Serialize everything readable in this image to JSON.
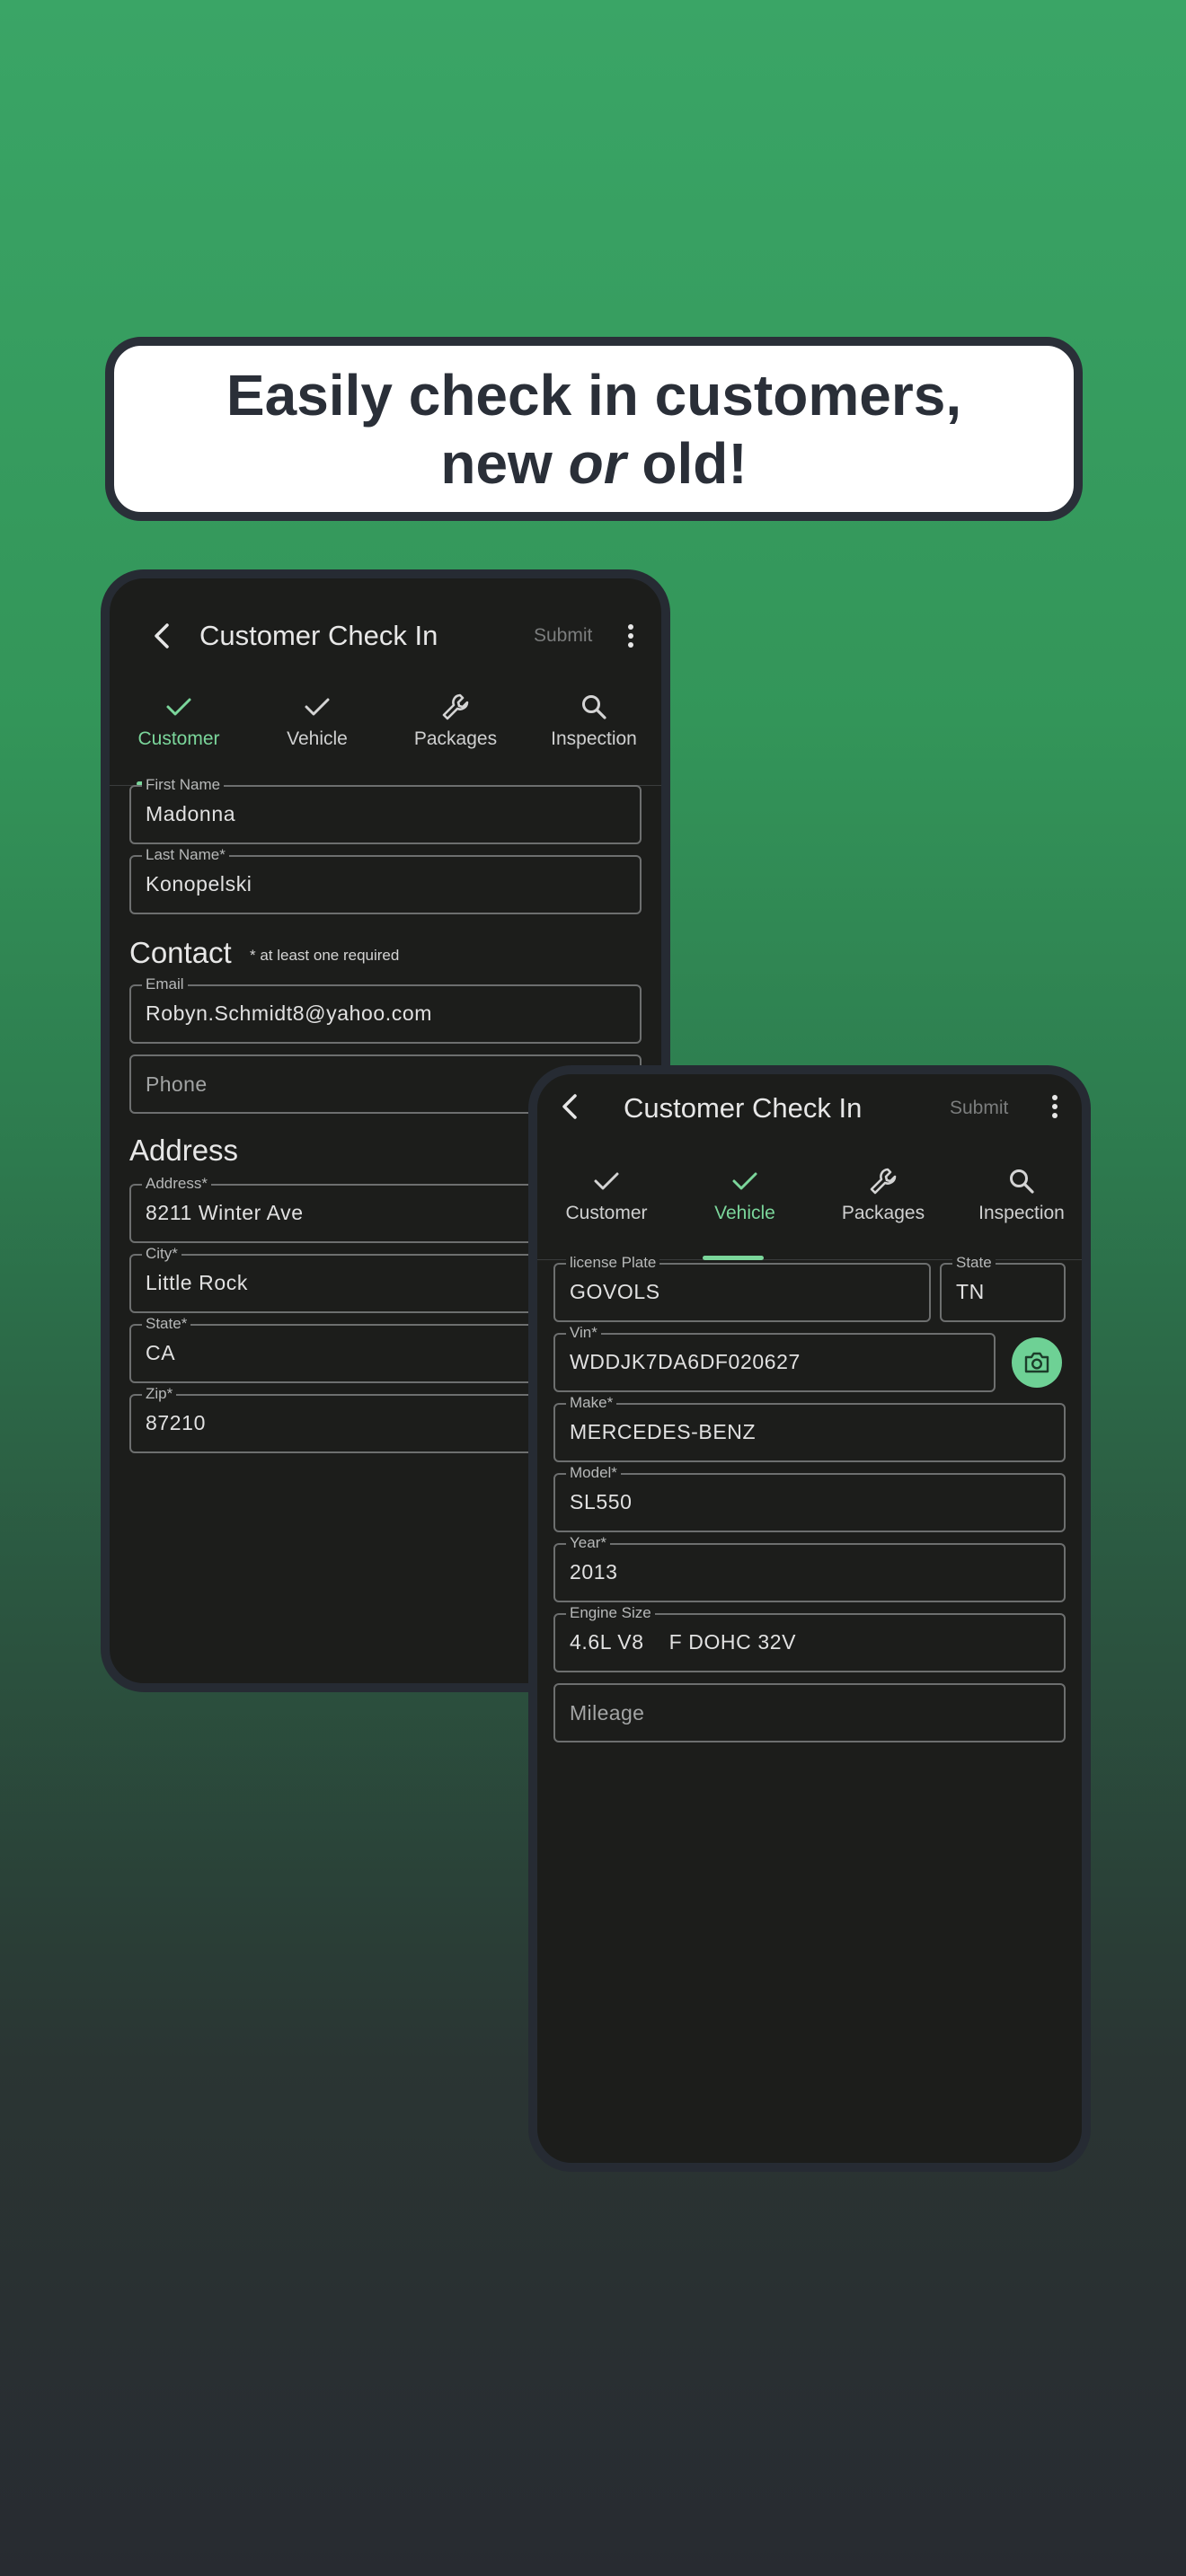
{
  "headline": {
    "line1": "Easily check in customers,",
    "line2_before": "new ",
    "line2_emph": "or",
    "line2_after": " old!"
  },
  "colors": {
    "accent": "#7bd69b",
    "background_top": "#3aa566",
    "background_bottom": "#282b31",
    "screen": "#1c1d1b",
    "frame": "#262b33"
  },
  "app": {
    "title": "Customer Check In",
    "submit_label": "Submit",
    "icons": {
      "back": "chevron-left-icon",
      "more": "more-vertical-icon"
    }
  },
  "tabs": [
    {
      "label": "Customer",
      "icon": "check-icon"
    },
    {
      "label": "Vehicle",
      "icon": "check-icon"
    },
    {
      "label": "Packages",
      "icon": "wrench-icon"
    },
    {
      "label": "Inspection",
      "icon": "search-icon"
    }
  ],
  "customer_screen": {
    "active_tab": "Customer",
    "first_name": {
      "label": "First Name",
      "value": "Madonna"
    },
    "last_name": {
      "label": "Last Name*",
      "value": "Konopelski"
    },
    "contact": {
      "heading": "Contact",
      "note": "* at least one required",
      "email": {
        "label": "Email",
        "value": "Robyn.Schmidt8@yahoo.com"
      },
      "phone": {
        "placeholder": "Phone"
      }
    },
    "address": {
      "heading": "Address",
      "street": {
        "label": "Address*",
        "value": "8211 Winter Ave"
      },
      "city": {
        "label": "City*",
        "value": "Little Rock"
      },
      "state": {
        "label": "State*",
        "value": "CA"
      },
      "zip": {
        "label": "Zip*",
        "value": "87210"
      }
    }
  },
  "vehicle_screen": {
    "active_tab": "Vehicle",
    "license_plate": {
      "label": "license Plate",
      "value": "GOVOLS"
    },
    "plate_state": {
      "label": "State",
      "value": "TN"
    },
    "vin": {
      "label": "Vin*",
      "value": "WDDJK7DA6DF020627",
      "scan_icon": "camera-icon"
    },
    "make": {
      "label": "Make*",
      "value": "MERCEDES-BENZ"
    },
    "model": {
      "label": "Model*",
      "value": "SL550"
    },
    "year": {
      "label": "Year*",
      "value": "2013"
    },
    "engine_size": {
      "label": "Engine Size",
      "value": "4.6L V8    F DOHC 32V"
    },
    "mileage": {
      "placeholder": "Mileage"
    }
  }
}
